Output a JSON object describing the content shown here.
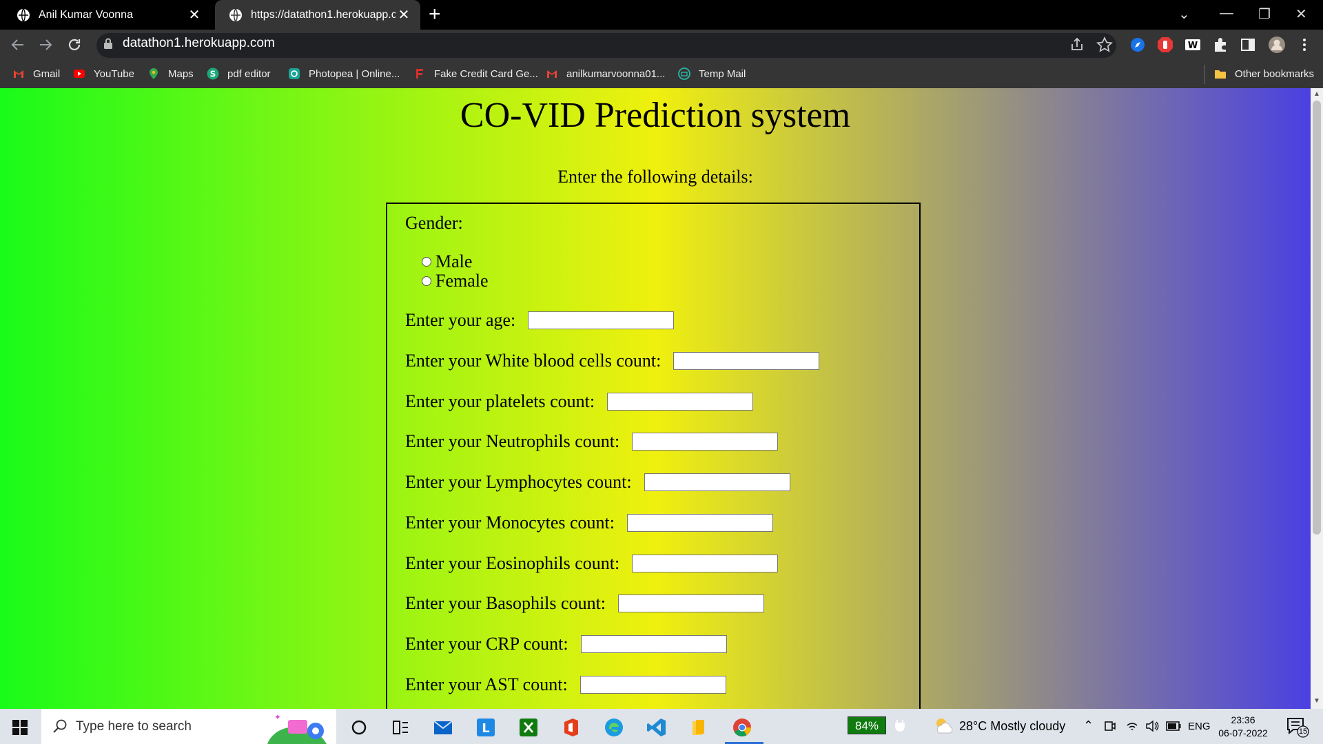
{
  "tabs": [
    {
      "title": "Anil Kumar Voonna"
    },
    {
      "title": "https://datathon1.herokuapp.com"
    }
  ],
  "address_bar": {
    "url": "datathon1.herokuapp.com"
  },
  "bookmarks": [
    {
      "label": "Gmail",
      "color": "#ea4335"
    },
    {
      "label": "YouTube",
      "color": "#ff0000"
    },
    {
      "label": "Maps",
      "color": "#34a853"
    },
    {
      "label": "pdf editor",
      "color": "#1ba97a"
    },
    {
      "label": "Photopea | Online...",
      "color": "#18a497"
    },
    {
      "label": "Fake Credit Card Ge...",
      "color": "#d32f2f"
    },
    {
      "label": "anilkumarvoonna01...",
      "color": "#ea4335"
    },
    {
      "label": "Temp Mail",
      "color": "#2bb5a8"
    }
  ],
  "other_bookmarks": "Other bookmarks",
  "page": {
    "title": "CO-VID Prediction system",
    "subtitle": "Enter the following details:",
    "gender_label": "Gender:",
    "gender_options": [
      "Male",
      "Female"
    ],
    "fields": [
      {
        "label": "Enter your age:"
      },
      {
        "label": "Enter your White blood cells count:"
      },
      {
        "label": "Enter your platelets count:"
      },
      {
        "label": "Enter your Neutrophils count:"
      },
      {
        "label": "Enter your Lymphocytes count:"
      },
      {
        "label": "Enter your Monocytes count:"
      },
      {
        "label": "Enter your Eosinophils count:"
      },
      {
        "label": "Enter your Basophils count:"
      },
      {
        "label": "Enter your CRP count:"
      },
      {
        "label": "Enter your AST count:"
      }
    ]
  },
  "taskbar": {
    "search_placeholder": "Type here to search",
    "battery": "84%",
    "weather": "28°C  Mostly cloudy",
    "language": "ENG",
    "time": "23:36",
    "date": "06-07-2022",
    "notifications": "15"
  }
}
